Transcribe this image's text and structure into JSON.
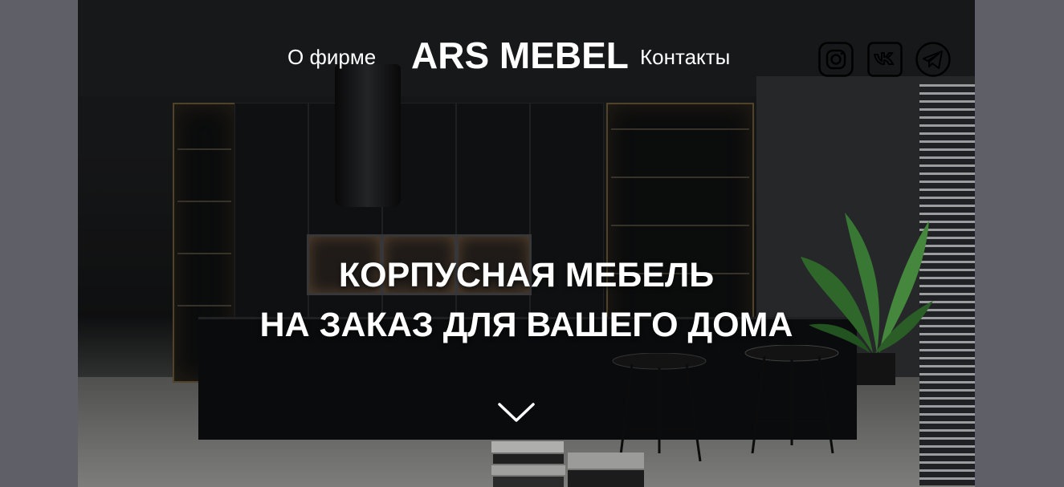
{
  "nav": {
    "about_label": "О фирме",
    "logo_text": "ARS MEBEL",
    "contacts_label": "Контакты"
  },
  "social": [
    {
      "icon": "instagram-icon"
    },
    {
      "icon": "vk-icon"
    },
    {
      "icon": "telegram-icon"
    }
  ],
  "hero": {
    "headline_line1": "КОРПУСНАЯ МЕБЕЛЬ",
    "headline_line2": "НА ЗАКАЗ ДЛЯ ВАШЕГО ДОМА",
    "scroll_icon": "chevron-down-icon"
  },
  "colors": {
    "page_background": "#5f6067",
    "text": "#ffffff"
  }
}
